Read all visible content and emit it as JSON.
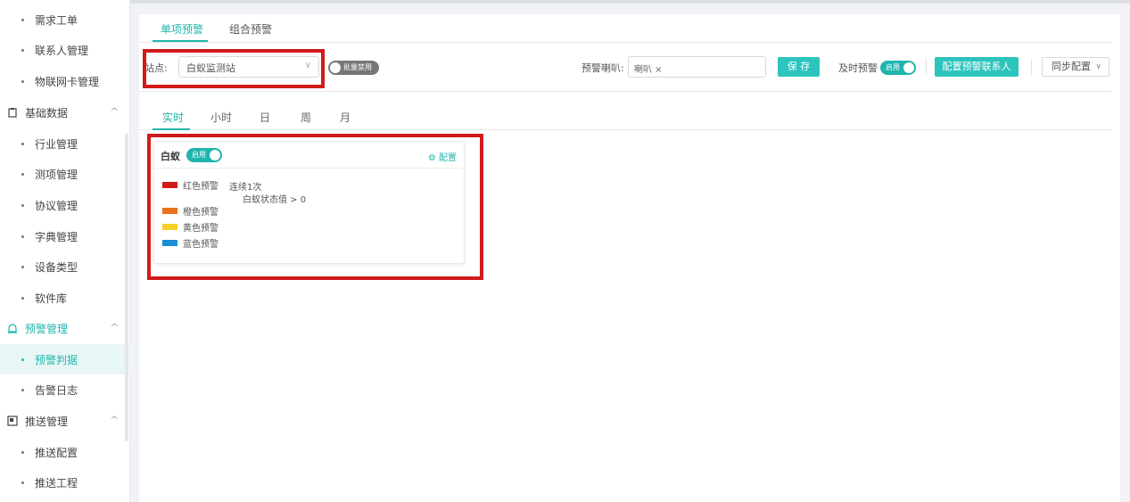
{
  "sidebar": {
    "items": [
      {
        "label": "需求工单",
        "type": "child"
      },
      {
        "label": "联系人管理",
        "type": "child"
      },
      {
        "label": "物联网卡管理",
        "type": "child"
      },
      {
        "label": "基础数据",
        "type": "group",
        "icon": "clipboard-icon"
      },
      {
        "label": "行业管理",
        "type": "child"
      },
      {
        "label": "测项管理",
        "type": "child"
      },
      {
        "label": "协议管理",
        "type": "child"
      },
      {
        "label": "字典管理",
        "type": "child"
      },
      {
        "label": "设备类型",
        "type": "child"
      },
      {
        "label": "软件库",
        "type": "child"
      },
      {
        "label": "预警管理",
        "type": "group",
        "icon": "alarm-icon"
      },
      {
        "label": "预警判据",
        "type": "child",
        "active": true
      },
      {
        "label": "告警日志",
        "type": "child"
      },
      {
        "label": "推送管理",
        "type": "group",
        "icon": "push-icon"
      },
      {
        "label": "推送配置",
        "type": "child"
      },
      {
        "label": "推送工程",
        "type": "child"
      }
    ]
  },
  "tabs": {
    "single": "单项预警",
    "combo": "组合预警"
  },
  "toolbar": {
    "site_label": "站点:",
    "site_value": "白蚁监测站",
    "batch_switch": "批量禁用",
    "speaker_label": "预警喇叭:",
    "speaker_tag": "喇叭 ×",
    "save": "保 存",
    "timely_label": "及时预警",
    "timely_switch": "启用",
    "contact_button": "配置预警联系人",
    "sync_button": "同步配置"
  },
  "period_tabs": [
    "实时",
    "小时",
    "日",
    "周",
    "月"
  ],
  "card": {
    "title": "白蚁",
    "switch": "启用",
    "config": "配置",
    "levels": [
      {
        "label": "红色预警",
        "color": "#d11a1a"
      },
      {
        "label": "橙色预警",
        "color": "#e8731c"
      },
      {
        "label": "黄色预警",
        "color": "#f5d12a"
      },
      {
        "label": "蓝色预警",
        "color": "#1a8fd6"
      }
    ],
    "conditions": [
      "连续1次",
      "白蚁状态值 > 0"
    ]
  },
  "colors": {
    "accent": "#1fb5ad",
    "highlight": "#d11a1a"
  }
}
